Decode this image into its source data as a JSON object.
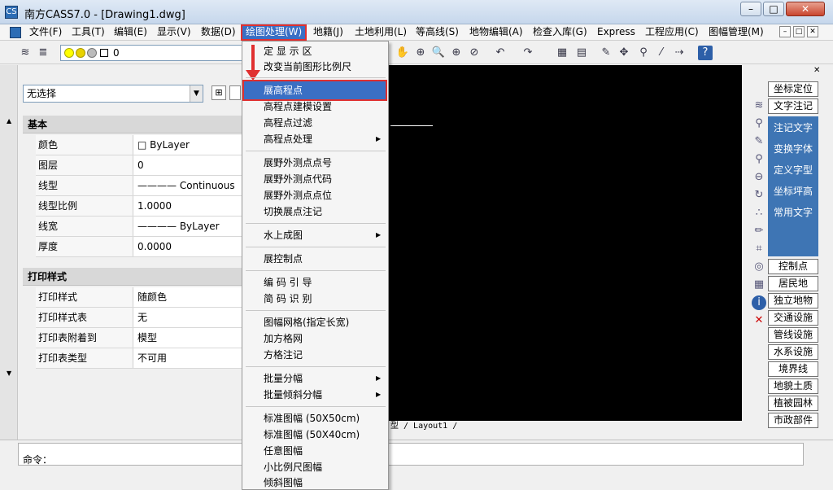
{
  "window": {
    "app_icon": "CS",
    "title": "南方CASS7.0 - [Drawing1.dwg]",
    "min": "–",
    "max": "□",
    "close": "✕"
  },
  "menubar": {
    "items": [
      "文件(F)",
      "工具(T)",
      "编辑(E)",
      "显示(V)",
      "数据(D)",
      "绘图处理(W)",
      "地籍(J)",
      "土地利用(L)",
      "等高线(S)",
      "地物编辑(A)",
      "检查入库(G)",
      "Express",
      "工程应用(C)",
      "图幅管理(M)"
    ],
    "mdi_min": "–",
    "mdi_max": "□",
    "mdi_close": "✕"
  },
  "toolbar": {
    "layer_value": "0"
  },
  "left_panel": {
    "selection": "无选择",
    "section_basic": "基本",
    "basic_rows": [
      {
        "k": "颜色",
        "v": "□ ByLayer"
      },
      {
        "k": "图层",
        "v": "0"
      },
      {
        "k": "线型",
        "v": "———— Continuous"
      },
      {
        "k": "线型比例",
        "v": "1.0000"
      },
      {
        "k": "线宽",
        "v": "———— ByLayer"
      },
      {
        "k": "厚度",
        "v": "0.0000"
      }
    ],
    "section_print": "打印样式",
    "print_rows": [
      {
        "k": "打印样式",
        "v": "随颜色"
      },
      {
        "k": "打印样式表",
        "v": "无"
      },
      {
        "k": "打印表附着到",
        "v": "模型"
      },
      {
        "k": "打印表类型",
        "v": "不可用"
      }
    ]
  },
  "dropdown": {
    "items": [
      "定 显 示 区",
      "改变当前图形比例尺",
      "展高程点",
      "高程点建模设置",
      "高程点过滤",
      "高程点处理",
      "展野外测点点号",
      "展野外测点代码",
      "展野外测点点位",
      "切换展点注记",
      "水上成图",
      "展控制点",
      "编 码 引 导",
      "简 码 识 别",
      "图幅网格(指定长宽)",
      "加方格网",
      "方格注记",
      "批量分幅",
      "批量倾斜分幅",
      "标准图幅 (50X50cm)",
      "标准图幅 (50X40cm)",
      "任意图幅",
      "小比例尺图幅",
      "倾斜图幅"
    ]
  },
  "canvas": {
    "layout_tabs": "型 / Layout1 /"
  },
  "command": {
    "label": "命令："
  },
  "right_panel": {
    "top_buttons": [
      "坐标定位",
      "文字注记"
    ],
    "blue_items": [
      "注记文字",
      "变换字体",
      "定义字型",
      "坐标坪高",
      "常用文字"
    ],
    "bottom_buttons": [
      "控制点",
      "居民地",
      "独立地物",
      "交通设施",
      "管线设施",
      "水系设施",
      "境界线",
      "地貌土质",
      "植被园林",
      "市政部件"
    ]
  }
}
